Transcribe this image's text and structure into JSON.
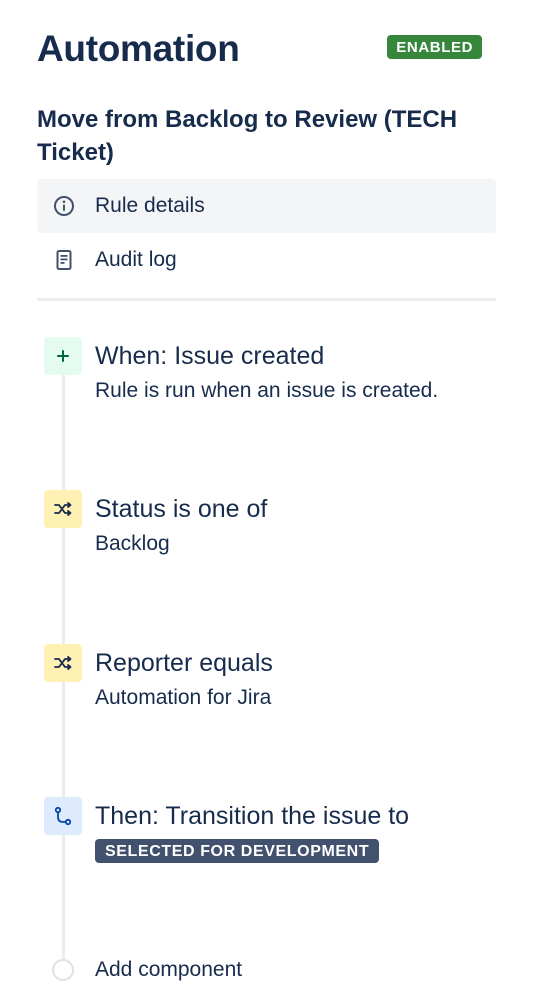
{
  "header": {
    "title": "Automation",
    "status_badge": "ENABLED"
  },
  "rule": {
    "name": "Move from Backlog to Review (TECH Ticket)"
  },
  "nav": {
    "items": [
      {
        "label": "Rule details",
        "icon": "info-icon",
        "selected": true
      },
      {
        "label": "Audit log",
        "icon": "document-icon",
        "selected": false
      }
    ]
  },
  "steps": [
    {
      "type": "trigger",
      "icon": "plus-icon",
      "title": "When: Issue created",
      "description": "Rule is run when an issue is created."
    },
    {
      "type": "condition",
      "icon": "shuffle-icon",
      "title": "Status is one of",
      "description": "Backlog"
    },
    {
      "type": "condition",
      "icon": "shuffle-icon",
      "title": "Reporter equals",
      "description": "Automation for Jira"
    },
    {
      "type": "action",
      "icon": "transition-icon",
      "title": "Then: Transition the issue to",
      "status_lozenge": "SELECTED FOR DEVELOPMENT"
    }
  ],
  "add_component": {
    "label": "Add component"
  },
  "colors": {
    "enabled_green": "#36873b",
    "text": "#172b4d",
    "trigger_bg": "#e3fcef",
    "condition_bg": "#fff0b3",
    "action_bg": "#deebff",
    "status_lozenge_bg": "#42526e"
  }
}
